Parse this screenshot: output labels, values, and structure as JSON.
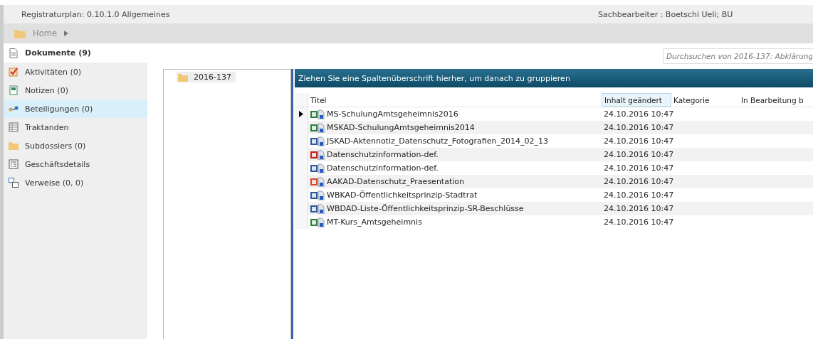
{
  "header": {
    "plan": "Registraturplan: 0.10.1.0 Allgemeines",
    "clerk": "Sachbearbeiter : Boetschi Ueli; BU"
  },
  "breadcrumb": [
    "Home"
  ],
  "sidebar": {
    "items": [
      {
        "label": "Dokumente (9)",
        "kind": "document",
        "selected": true,
        "highlighted": false
      },
      {
        "label": "Aktivitäten (0)",
        "kind": "task",
        "selected": false,
        "highlighted": false
      },
      {
        "label": "Notizen (0)",
        "kind": "note",
        "selected": false,
        "highlighted": false
      },
      {
        "label": "Beteiligungen (0)",
        "kind": "people",
        "selected": false,
        "highlighted": true
      },
      {
        "label": "Traktanden",
        "kind": "table",
        "selected": false,
        "highlighted": false
      },
      {
        "label": "Subdossiers (0)",
        "kind": "folder",
        "selected": false,
        "highlighted": false
      },
      {
        "label": "Geschäftsdetails",
        "kind": "form",
        "selected": false,
        "highlighted": false
      },
      {
        "label": "Verweise (0, 0)",
        "kind": "links",
        "selected": false,
        "highlighted": false
      }
    ]
  },
  "search": {
    "placeholder": "Durchsuchen von 2016-137: Abklärung"
  },
  "tree": [
    {
      "label": "2016-137",
      "selected": true
    }
  ],
  "grid": {
    "group_panel": "Ziehen Sie eine Spaltenüberschrift hierher, um danach zu gruppieren",
    "columns": [
      {
        "label": "Titel",
        "sorted": false
      },
      {
        "label": "Inhalt geändert",
        "sorted": true
      },
      {
        "label": "Kategorie",
        "sorted": false
      },
      {
        "label": "In Bearbeitung b",
        "sorted": false
      }
    ],
    "rows": [
      {
        "kind": "excel",
        "title": "MS-SchulungAmtsgeheimnis2016",
        "changed": "24.10.2016 10:47",
        "selected": true
      },
      {
        "kind": "excel",
        "title": "MSKAD-SchulungAmtsgeheimnis2014",
        "changed": "24.10.2016 10:47",
        "selected": false
      },
      {
        "kind": "word",
        "title": "JSKAD-Aktennotiz_Datenschutz_Fotografien_2014_02_13",
        "changed": "24.10.2016 10:47",
        "selected": false
      },
      {
        "kind": "pdf",
        "title": "Datenschutzinformation-def.",
        "changed": "24.10.2016 10:47",
        "selected": false
      },
      {
        "kind": "word",
        "title": "Datenschutzinformation-def.",
        "changed": "24.10.2016 10:47",
        "selected": false
      },
      {
        "kind": "powerpoint",
        "title": "AAKAD-Datenschutz_Praesentation",
        "changed": "24.10.2016 10:47",
        "selected": false
      },
      {
        "kind": "word",
        "title": "WBKAD-Öffentlichkeitsprinzip-Stadtrat",
        "changed": "24.10.2016 10:47",
        "selected": false
      },
      {
        "kind": "word",
        "title": "WBDAD-Liste-Öffentlichkeitsprinzip-SR-Beschlüsse",
        "changed": "24.10.2016 10:47",
        "selected": false
      },
      {
        "kind": "excel",
        "title": "MT-Kurs_Amtsgeheimnis",
        "changed": "24.10.2016 10:47",
        "selected": false
      }
    ]
  }
}
